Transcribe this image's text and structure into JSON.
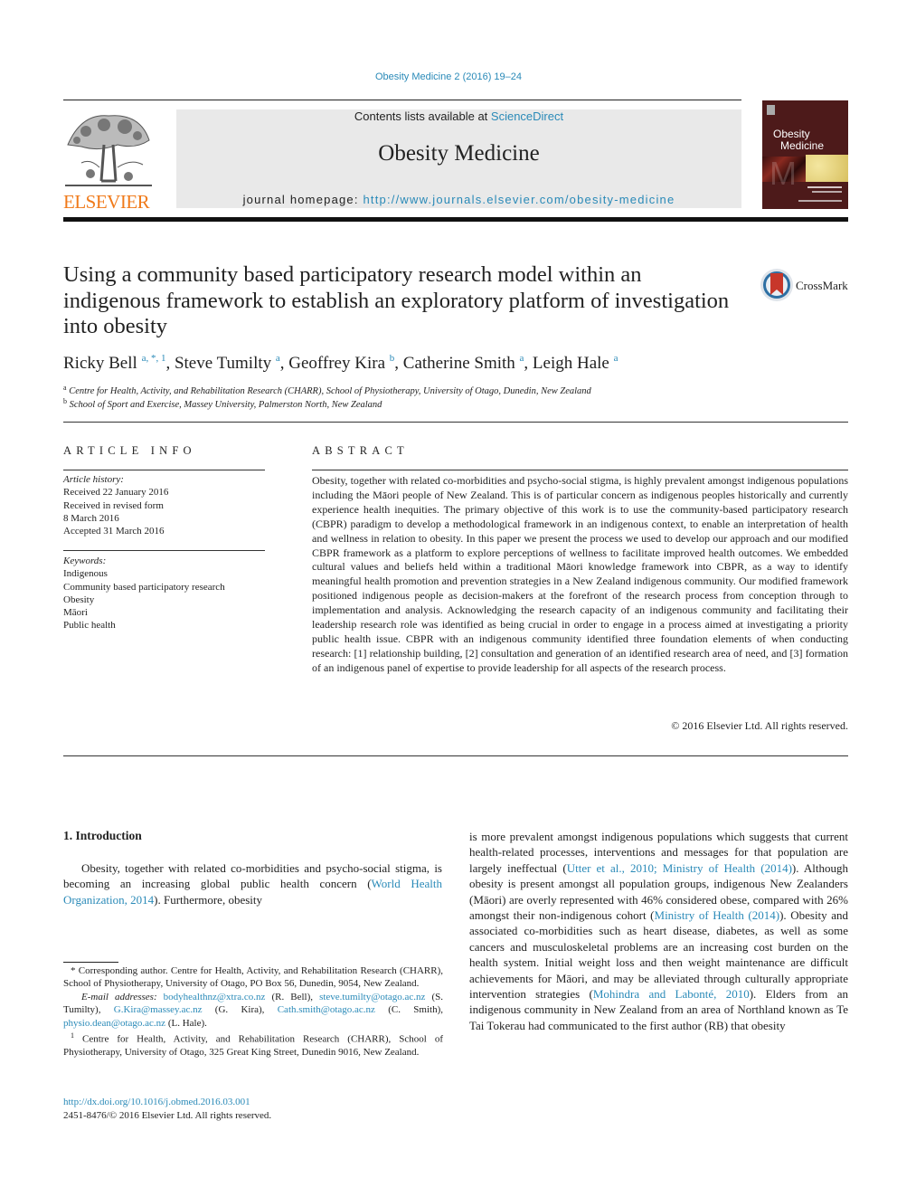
{
  "header": {
    "citation": "Obesity Medicine 2 (2016) 19–24",
    "contents_prefix": "Contents lists available at ",
    "contents_link": "ScienceDirect",
    "journal_name": "Obesity Medicine",
    "homepage_prefix": "journal homepage: ",
    "homepage_url": "http://www.journals.elsevier.com/obesity-medicine",
    "publisher_wordmark": "ELSEVIER",
    "cover_title_line1": "Obesity",
    "cover_title_line2": "Medicine",
    "crossmark_label": "CrossMark"
  },
  "colors": {
    "link": "#2a8ab8",
    "elsevier_orange": "#f07a1a",
    "cover_bg": "#4d1a1a",
    "banner_bg": "#e9e9e9"
  },
  "article": {
    "title": "Using a community based participatory research model within an indigenous framework to establish an exploratory platform of investigation into obesity",
    "authors": [
      {
        "name": "Ricky Bell",
        "sup": "a, *, 1"
      },
      {
        "name": "Steve Tumilty",
        "sup": "a"
      },
      {
        "name": "Geoffrey Kira",
        "sup": "b"
      },
      {
        "name": "Catherine Smith",
        "sup": "a"
      },
      {
        "name": "Leigh Hale",
        "sup": "a"
      }
    ],
    "affiliations": [
      {
        "mark": "a",
        "text": "Centre for Health, Activity, and Rehabilitation Research (CHARR), School of Physiotherapy, University of Otago, Dunedin, New Zealand"
      },
      {
        "mark": "b",
        "text": "School of Sport and Exercise, Massey University, Palmerston North, New Zealand"
      }
    ]
  },
  "article_info": {
    "heading": "ARTICLE INFO",
    "history_label": "Article history:",
    "history": [
      "Received 22 January 2016",
      "Received in revised form",
      "8 March 2016",
      "Accepted 31 March 2016"
    ],
    "keywords_label": "Keywords:",
    "keywords": [
      "Indigenous",
      "Community based participatory research",
      "Obesity",
      "Māori",
      "Public health"
    ]
  },
  "abstract": {
    "heading": "ABSTRACT",
    "text": "Obesity, together with related co-morbidities and psycho-social stigma, is highly prevalent amongst indigenous populations including the Māori people of New Zealand. This is of particular concern as indigenous peoples historically and currently experience health inequities. The primary objective of this work is to use the community-based participatory research (CBPR) paradigm to develop a methodological framework in an indigenous context, to enable an interpretation of health and wellness in relation to obesity. In this paper we present the process we used to develop our approach and our modified CBPR framework as a platform to explore perceptions of wellness to facilitate improved health outcomes. We embedded cultural values and beliefs held within a traditional Māori knowledge framework into CBPR, as a way to identify meaningful health promotion and prevention strategies in a New Zealand indigenous community. Our modified framework positioned indigenous people as decision-makers at the forefront of the research process from conception through to implementation and analysis. Acknowledging the research capacity of an indigenous community and facilitating their leadership research role was identified as being crucial in order to engage in a process aimed at investigating a priority public health issue. CBPR with an indigenous community identified three foundation elements of when conducting research: [1] relationship building, [2] consultation and generation of an identified research area of need, and [3] formation of an indigenous panel of expertise to provide leadership for all aspects of the research process.",
    "copyright": "© 2016 Elsevier Ltd. All rights reserved."
  },
  "intro": {
    "heading": "1.  Introduction",
    "left_p1": "Obesity, together with related co-morbidities and psycho-social stigma, is becoming an increasing global public health concern (",
    "left_link1": "World Health Organization, 2014",
    "left_p2": "). Furthermore, obesity",
    "right_p1": "is more prevalent amongst indigenous populations which suggests that current health-related processes, interventions and messages for that population are largely ineffectual (",
    "right_link1": "Utter et al., 2010; Ministry of Health (2014)",
    "right_p2": "). Although obesity is present amongst all population groups, indigenous New Zealanders (Māori) are overly represented with 46% considered obese, compared with 26% amongst their non-indigenous cohort (",
    "right_link2": "Ministry of Health (2014)",
    "right_p3": "). Obesity and associated co-morbidities such as heart disease, diabetes, as well as some cancers and musculoskeletal problems are an increasing cost burden on the health system. Initial weight loss and then weight maintenance are difficult achievements for Māori, and may be alleviated through culturally appropriate intervention strategies (",
    "right_link3": "Mohindra and Labonté, 2010",
    "right_p4": "). Elders from an indigenous community in New Zealand from an area of Northland known as Te Tai Tokerau had communicated to the first author (RB) that obesity"
  },
  "footnotes": {
    "corresponding": "* Corresponding author. Centre for Health, Activity, and Rehabilitation Research (CHARR), School of Physiotherapy, University of Otago, PO Box 56, Dunedin, 9054, New Zealand.",
    "email_label": "E-mail addresses:",
    "emails": [
      {
        "addr": "bodyhealthnz@xtra.co.nz",
        "who": " (R. Bell), "
      },
      {
        "addr": "steve.tumilty@otago.ac.nz",
        "who": " (S. Tumilty), "
      },
      {
        "addr": "G.Kira@massey.ac.nz",
        "who": " (G. Kira), "
      },
      {
        "addr": "Cath.smith@otago.ac.nz",
        "who": " (C. Smith), "
      },
      {
        "addr": "physio.dean@otago.ac.nz",
        "who": " (L. Hale)."
      }
    ],
    "note1_mark": "1",
    "note1": " Centre for Health, Activity, and Rehabilitation Research (CHARR), School of Physiotherapy, University of Otago, 325 Great King Street, Dunedin 9016, New Zealand."
  },
  "doi": {
    "url": "http://dx.doi.org/10.1016/j.obmed.2016.03.001",
    "issn_line": "2451-8476/© 2016 Elsevier Ltd. All rights reserved."
  }
}
